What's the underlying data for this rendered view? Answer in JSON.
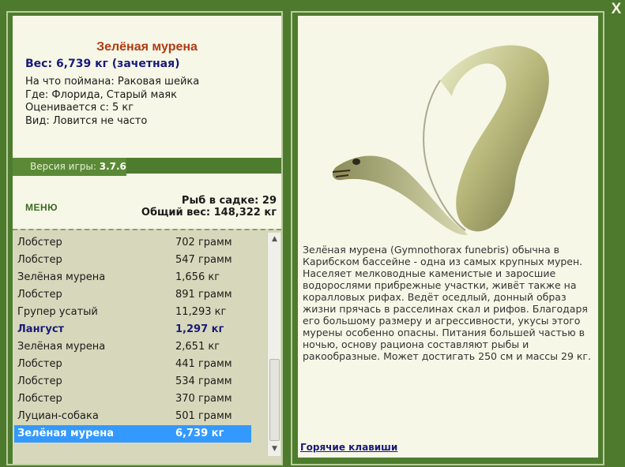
{
  "window": {
    "close_label": "X"
  },
  "fish": {
    "title": "Зелёная мурена",
    "weight_line": "Вес: 6,739 кг (зачетная)",
    "props": [
      "На что поймана: Раковая шейка",
      "Где: Флорида, Старый маяк",
      "Оценивается с: 5 кг",
      "Вид: Ловится не часто"
    ]
  },
  "version": {
    "label": "Версия игры: ",
    "value": "3.7.6"
  },
  "menu_label": "МЕНЮ",
  "stats": {
    "fish_in_cage": "Рыб в садке: 29",
    "total_weight": "Общий вес: 148,322 кг"
  },
  "catch_list": [
    {
      "name": "Лобстер",
      "weight": "702 грамм",
      "state": "normal"
    },
    {
      "name": "Лобстер",
      "weight": "547 грамм",
      "state": "normal"
    },
    {
      "name": "Зелёная мурена",
      "weight": "1,656 кг",
      "state": "normal"
    },
    {
      "name": "Лобстер",
      "weight": "891 грамм",
      "state": "normal"
    },
    {
      "name": "Групер усатый",
      "weight": "11,293 кг",
      "state": "normal"
    },
    {
      "name": "Лангуст",
      "weight": "1,297 кг",
      "state": "highlight"
    },
    {
      "name": "Зелёная мурена",
      "weight": "2,651 кг",
      "state": "normal"
    },
    {
      "name": "Лобстер",
      "weight": "441 грамм",
      "state": "normal"
    },
    {
      "name": "Лобстер",
      "weight": "534 грамм",
      "state": "normal"
    },
    {
      "name": "Лобстер",
      "weight": "370 грамм",
      "state": "normal"
    },
    {
      "name": "Луциан-собака",
      "weight": "501 грамм",
      "state": "normal"
    },
    {
      "name": "Зелёная мурена",
      "weight": "6,739 кг",
      "state": "selected"
    }
  ],
  "description": "Зелёная мурена (Gymnothorax funebris) обычна в\nКарибском бассейне - одна из самых крупных мурен.\nНаселяет мелководные каменистые и заросшие\nводорослями прибрежные участки, живёт также на\nкоралловых рифах. Ведёт оседлый, донный образ\nжизни прячась в расселинах скал и рифов. Благодаря\nего большому размеру и агрессивности, укусы этого\nмурены особенно опасны. Питания большей частью в\nночью, основу рациона составляют рыбы и\nракообразные. Может достигать 250 см и массы 29 кг.",
  "hotkeys_label": "Горячие клавиши"
}
